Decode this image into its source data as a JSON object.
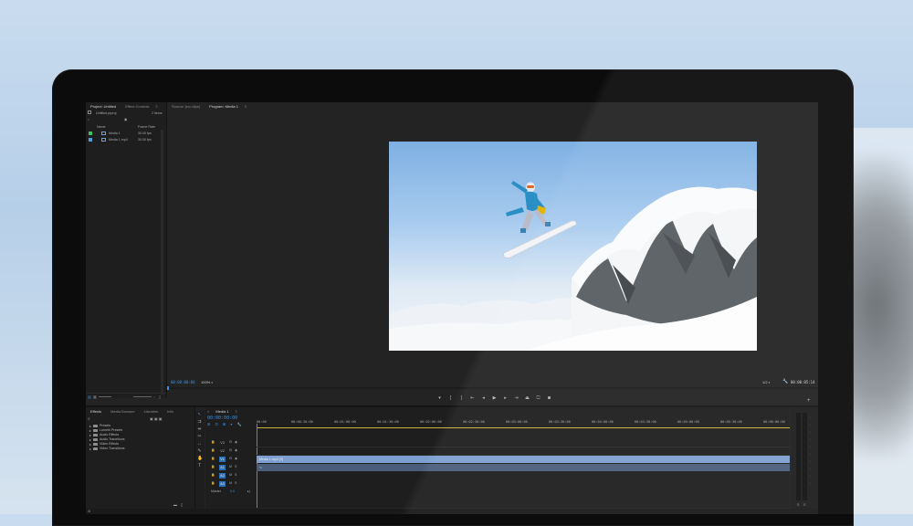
{
  "project_panel": {
    "tabs": [
      "Project: Untitled",
      "Effect Controls"
    ],
    "file_name": "Untitled.prproj",
    "item_count": "2 items",
    "col_name": "Name",
    "col_framerate": "Frame Rate",
    "items": [
      {
        "name": "Media 1",
        "rate": "30.00 fps",
        "color": "#3fbf5f"
      },
      {
        "name": "Media 1.mp4",
        "rate": "30.00 fps",
        "color": "#4aa0d8"
      }
    ]
  },
  "monitor_tabs": [
    "Source: (no clips)",
    "Program: Media 1"
  ],
  "program": {
    "timecode_left": "00:00:00:00",
    "zoom": "100%",
    "quality": "1/2",
    "timecode_right": "00:00:05:14"
  },
  "effects_panel": {
    "tabs": [
      "Effects",
      "Media Browser",
      "Libraries",
      "Info"
    ],
    "items": [
      "Presets",
      "Lumetri Presets",
      "Audio Effects",
      "Audio Transitions",
      "Video Effects",
      "Video Transitions"
    ]
  },
  "timeline": {
    "tab": "Media 1",
    "timecode": "00:00:00:00",
    "ruler": [
      "00:00",
      "00:00:30:00",
      "00:01:00:00",
      "00:01:30:00",
      "00:02:00:00",
      "00:02:30:00",
      "00:03:00:00",
      "00:03:30:00",
      "00:04:00:00",
      "00:04:30:00",
      "00:05:00:00",
      "00:05:30:00",
      "00:06:00:00"
    ],
    "video_tracks": [
      "V3",
      "V2",
      "V1"
    ],
    "audio_tracks": [
      "A1",
      "A2",
      "A3"
    ],
    "master_label": "Master",
    "master_value": "0.0",
    "video_clip_label": "Media 1.mp4 [V]",
    "clip_color_video": "#7d9fcf",
    "clip_color_audio": "#4a5e7c"
  },
  "meter": {
    "labels": [
      "S",
      "S"
    ]
  }
}
